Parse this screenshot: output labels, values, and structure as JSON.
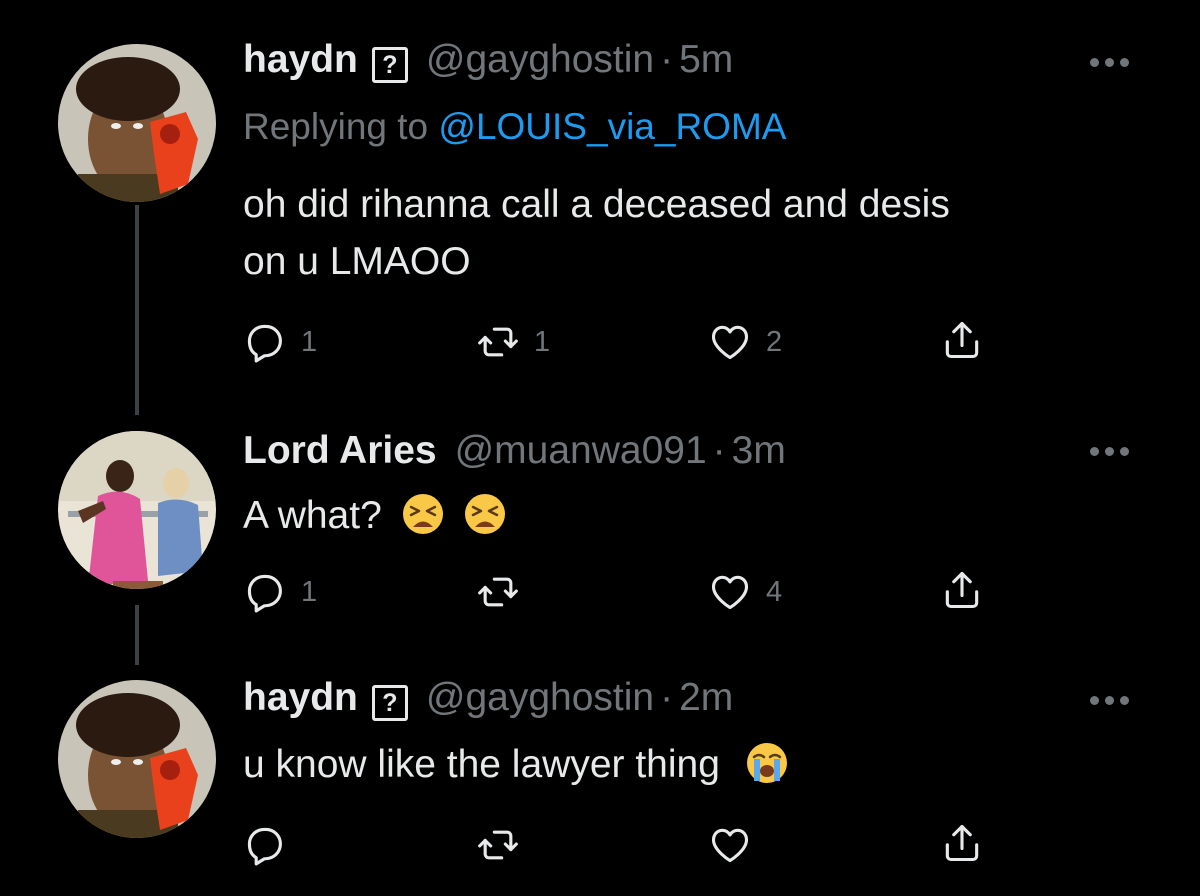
{
  "tweets": [
    {
      "name": "haydn",
      "badge": "?",
      "handle": "@gayghostin",
      "sep": "·",
      "time": "5m",
      "replying_prefix": "Replying to",
      "replying_to": "@LOUIS_via_ROMA",
      "text_line1": "oh did rihanna call a deceased and desis",
      "text_line2": "on u LMAOO",
      "replies": "1",
      "retweets": "1",
      "likes": "2"
    },
    {
      "name": "Lord Aries",
      "handle": "@muanwa091",
      "sep": "·",
      "time": "3m",
      "text": "A what?",
      "emoji": [
        "tired-face-emoji",
        "tired-face-emoji"
      ],
      "replies": "1",
      "retweets": "",
      "likes": "4"
    },
    {
      "name": "haydn",
      "badge": "?",
      "handle": "@gayghostin",
      "sep": "·",
      "time": "2m",
      "text": "u know like the lawyer thing",
      "emoji": [
        "loudly-crying-face-emoji"
      ],
      "replies": "",
      "retweets": "",
      "likes": ""
    }
  ],
  "colors": {
    "background": "#000000",
    "text": "#e7e9ea",
    "secondary": "#71767b",
    "link": "#1d9bf0",
    "thread_line": "#3e4144"
  }
}
